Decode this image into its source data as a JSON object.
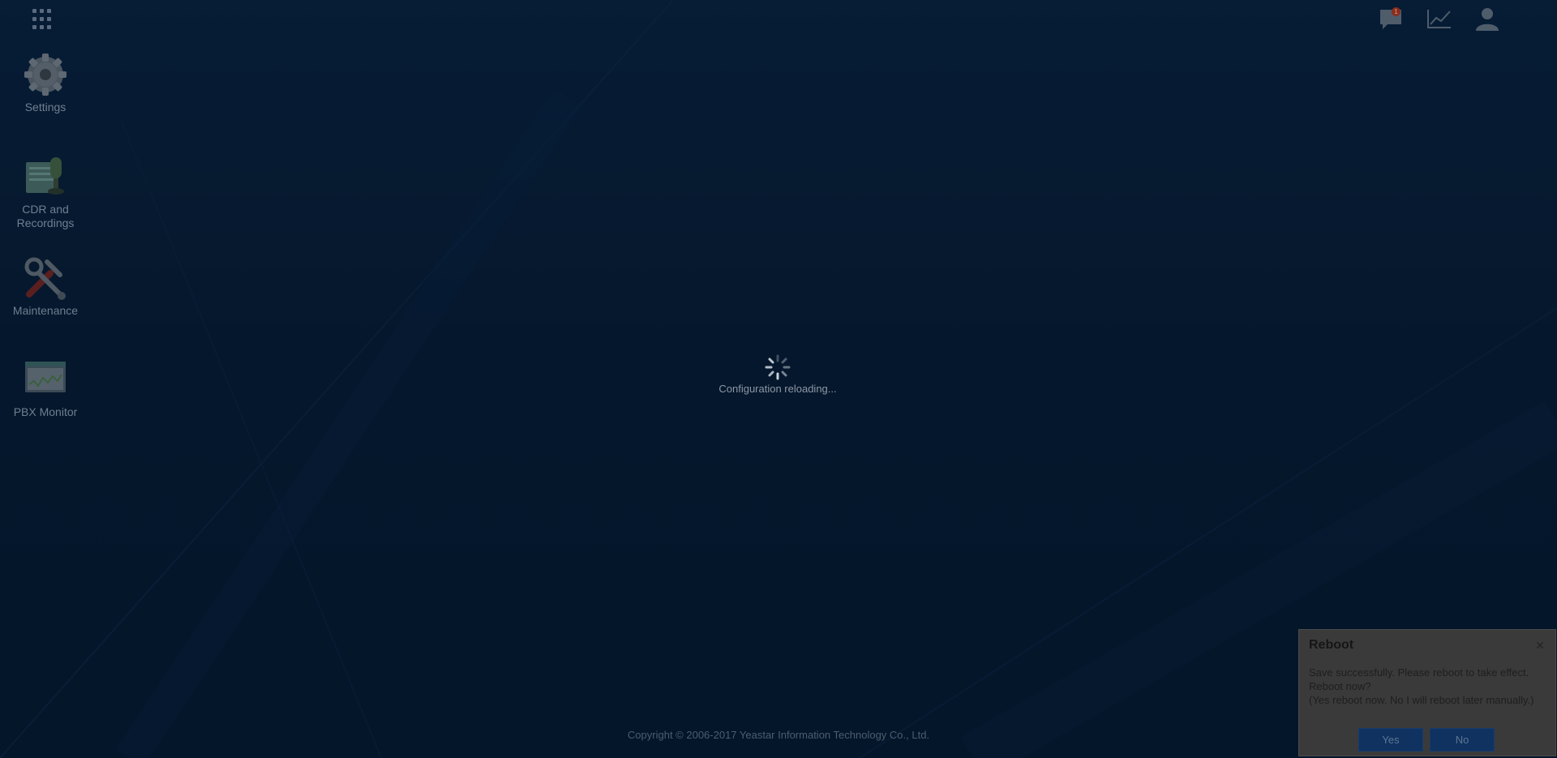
{
  "apps_button": {
    "icon": "apps-grid-icon"
  },
  "desktop": {
    "items": [
      {
        "label": "Settings",
        "icon": "gear-icon"
      },
      {
        "label": "CDR and Recordings",
        "icon": "cdr-recordings-icon"
      },
      {
        "label": "Maintenance",
        "icon": "tools-icon"
      },
      {
        "label": "PBX Monitor",
        "icon": "monitor-icon"
      }
    ]
  },
  "toolbar": {
    "messages": {
      "icon": "message-icon",
      "badge": "1"
    },
    "statistics": {
      "icon": "chart-line-icon"
    },
    "account": {
      "icon": "user-icon"
    }
  },
  "loading": {
    "text": "Configuration reloading..."
  },
  "footer": {
    "copyright": "Copyright © 2006-2017 Yeastar Information Technology Co., Ltd."
  },
  "dialog": {
    "title": "Reboot",
    "lines": [
      "Save successfully. Please reboot to take effect.",
      "Reboot now?",
      "(Yes reboot now. No I will reboot later manually.)"
    ],
    "yes_label": "Yes",
    "no_label": "No"
  },
  "colors": {
    "background": "#08213f",
    "button": "#0f3260"
  }
}
